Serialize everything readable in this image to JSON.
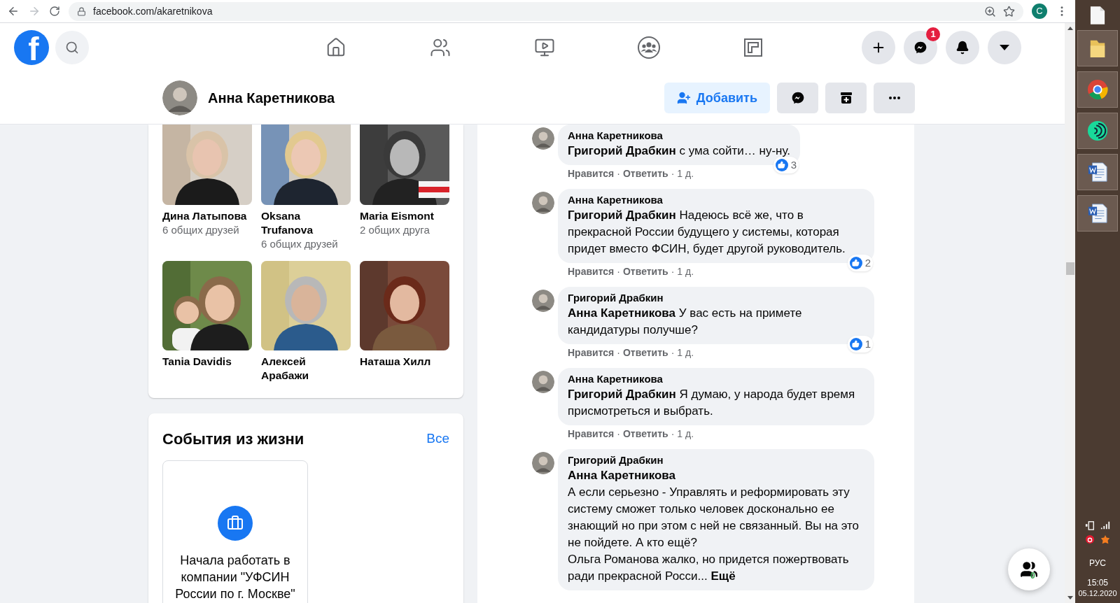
{
  "browser": {
    "url": "facebook.com/akaretnikova",
    "profile_initial": "C"
  },
  "header": {
    "logo": "f",
    "messenger_badge": "1"
  },
  "profile_bar": {
    "name": "Анна Каретникова",
    "add_button": "Добавить"
  },
  "friends": [
    {
      "name": "Дина Латыпова",
      "mutual": "6 общих друзей"
    },
    {
      "name": "Oksana Trufanova",
      "mutual": "6 общих друзей"
    },
    {
      "name": "Maria Eismont",
      "mutual": "2 общих друга"
    },
    {
      "name": "Tania Davidis"
    },
    {
      "name": "Алексей Арабажи"
    },
    {
      "name": "Наташа Хилл"
    }
  ],
  "life_events": {
    "title": "События из жизни",
    "all_link": "Все",
    "event": "Начала работать в компании \"УФСИН России по г. Москве\""
  },
  "separator": "·",
  "comments": [
    {
      "author": "Анна Каретникова",
      "text": "**Григорий Драбкин** с ума сойти… ну-ну.",
      "like": "Нравится",
      "reply": "Ответить",
      "time": "1 д.",
      "reactions": "3"
    },
    {
      "author": "Анна Каретникова",
      "text": "**Григорий Драбкин** Надеюсь всё же, что в прекрасной России будущего у системы, которая придет вместо ФСИН, будет другой руководитель.",
      "like": "Нравится",
      "reply": "Ответить",
      "time": "1 д.",
      "reactions": "2"
    },
    {
      "author": "Григорий Драбкин",
      "text": "**Анна Каретникова** У вас есть на примете кандидатуры получше?",
      "like": "Нравится",
      "reply": "Ответить",
      "time": "1 д.",
      "reactions": "1"
    },
    {
      "author": "Анна Каретникова",
      "text": "**Григорий Драбкин** Я думаю, у народа будет время присмотреться и выбрать.",
      "like": "Нравится",
      "reply": "Ответить",
      "time": "1 д."
    },
    {
      "author": "Григорий Драбкин",
      "text": "**Анна Каретникова**\nА если серьезно - Управлять и реформировать эту систему сможет только человек досконально ее знающий но при этом с ней не связанный. Вы на это не пойдете. А кто ещё?\nОльга Романова жалко, но придется пожертвовать ради прекрасной Росси...",
      "more": "Ещё"
    }
  ],
  "contacts_badge": "0",
  "taskbar": {
    "language": "РУС",
    "time": "15:05",
    "date": "05.12.2020"
  }
}
